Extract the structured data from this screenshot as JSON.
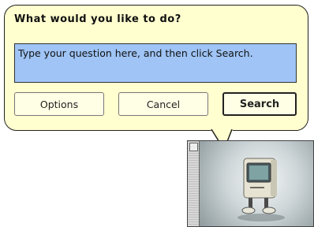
{
  "dialog": {
    "title": "What would you like to do?",
    "question_placeholder": "Type your question here, and then click Search.",
    "buttons": {
      "options": "Options",
      "cancel": "Cancel",
      "search": "Search"
    }
  },
  "assistant": {
    "character": "mac-computer-icon"
  },
  "colors": {
    "balloon_bg": "#ffffcf",
    "input_bg": "#9fc4f5",
    "border": "#222222"
  }
}
